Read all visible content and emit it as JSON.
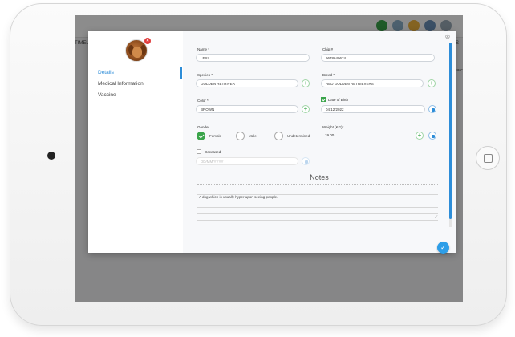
{
  "background": {
    "left_label": "TIMELI",
    "right_label": "S",
    "right_label2": "earch"
  },
  "modal": {
    "close_icon": "close-icon",
    "sidebar": {
      "items": [
        {
          "label": "Details",
          "active": true
        },
        {
          "label": "Medical Information",
          "active": false
        },
        {
          "label": "Vaccine",
          "active": false
        }
      ]
    },
    "form": {
      "name": {
        "label": "Name *",
        "value": "LEXI"
      },
      "chip": {
        "label": "Chip #",
        "value": "9678649674"
      },
      "species": {
        "label": "Species *",
        "value": "GOLDEN RETRIVER"
      },
      "breed": {
        "label": "Breed *",
        "value": "RED GOLDEN RETRIEVERS"
      },
      "color": {
        "label": "Color *",
        "value": "BROWN"
      },
      "dob": {
        "label": "Date of Birth",
        "checked": true,
        "value": "04/12/2022"
      },
      "gender": {
        "label": "Gender",
        "options": [
          {
            "label": "Female",
            "selected": true
          },
          {
            "label": "Male",
            "selected": false
          },
          {
            "label": "Undetermined",
            "selected": false
          }
        ]
      },
      "weight": {
        "label": "Weight (KG)*",
        "value": "19.00"
      },
      "deceased": {
        "label": "Deceased",
        "checked": false,
        "date_placeholder": "DD/MM/YYYY"
      }
    },
    "notes": {
      "title": "Notes",
      "text": "A dog which is usually hyper upon seeing people."
    }
  },
  "colors": {
    "accent": "#2d8dd8",
    "add": "#3aa44a",
    "remove": "#e03c3c"
  }
}
